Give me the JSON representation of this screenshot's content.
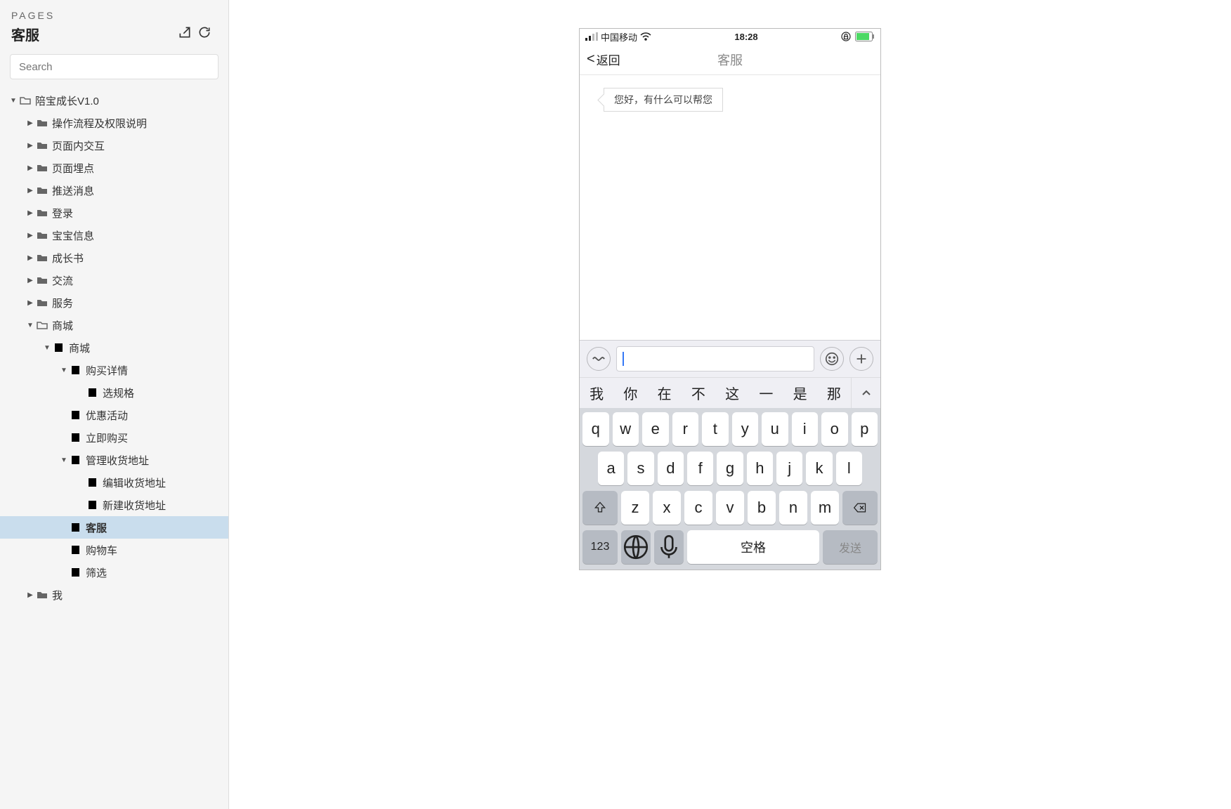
{
  "sidebar": {
    "header_label": "PAGES",
    "current_page": "客服",
    "search_placeholder": "Search",
    "tree": [
      {
        "depth": 0,
        "expanded": true,
        "icon": "folder-open",
        "label": "陪宝成长V1.0"
      },
      {
        "depth": 1,
        "expanded": false,
        "icon": "folder-closed",
        "label": "操作流程及权限说明"
      },
      {
        "depth": 1,
        "expanded": false,
        "icon": "folder-closed",
        "label": "页面内交互"
      },
      {
        "depth": 1,
        "expanded": false,
        "icon": "folder-closed",
        "label": "页面埋点"
      },
      {
        "depth": 1,
        "expanded": false,
        "icon": "folder-closed",
        "label": "推送消息"
      },
      {
        "depth": 1,
        "expanded": false,
        "icon": "folder-closed",
        "label": "登录"
      },
      {
        "depth": 1,
        "expanded": false,
        "icon": "folder-closed",
        "label": "宝宝信息"
      },
      {
        "depth": 1,
        "expanded": false,
        "icon": "folder-closed",
        "label": "成长书"
      },
      {
        "depth": 1,
        "expanded": false,
        "icon": "folder-closed",
        "label": "交流"
      },
      {
        "depth": 1,
        "expanded": false,
        "icon": "folder-closed",
        "label": "服务"
      },
      {
        "depth": 1,
        "expanded": true,
        "icon": "folder-open",
        "label": "商城"
      },
      {
        "depth": 2,
        "expanded": true,
        "icon": "page",
        "label": "商城"
      },
      {
        "depth": 3,
        "expanded": true,
        "icon": "page",
        "label": "购买详情"
      },
      {
        "depth": 4,
        "expanded": null,
        "icon": "page",
        "label": "选规格"
      },
      {
        "depth": 3,
        "expanded": null,
        "icon": "page",
        "label": "优惠活动"
      },
      {
        "depth": 3,
        "expanded": null,
        "icon": "page",
        "label": "立即购买"
      },
      {
        "depth": 3,
        "expanded": true,
        "icon": "page",
        "label": "管理收货地址"
      },
      {
        "depth": 4,
        "expanded": null,
        "icon": "page",
        "label": "编辑收货地址"
      },
      {
        "depth": 4,
        "expanded": null,
        "icon": "page",
        "label": "新建收货地址"
      },
      {
        "depth": 3,
        "expanded": null,
        "icon": "page",
        "label": "客服",
        "selected": true
      },
      {
        "depth": 3,
        "expanded": null,
        "icon": "page",
        "label": "购物车"
      },
      {
        "depth": 3,
        "expanded": null,
        "icon": "page",
        "label": "筛选"
      },
      {
        "depth": 1,
        "expanded": false,
        "icon": "folder-closed",
        "label": "我"
      }
    ]
  },
  "phone": {
    "status": {
      "carrier": "中国移动",
      "time": "18:28"
    },
    "nav": {
      "back": "返回",
      "title": "客服"
    },
    "chat": {
      "msg1": "您好，有什么可以帮您"
    },
    "suggest": [
      "我",
      "你",
      "在",
      "不",
      "这",
      "一",
      "是",
      "那"
    ],
    "keyboard": {
      "row1": [
        "q",
        "w",
        "e",
        "r",
        "t",
        "y",
        "u",
        "i",
        "o",
        "p"
      ],
      "row2": [
        "a",
        "s",
        "d",
        "f",
        "g",
        "h",
        "j",
        "k",
        "l"
      ],
      "row3": [
        "z",
        "x",
        "c",
        "v",
        "b",
        "n",
        "m"
      ],
      "num": "123",
      "space": "空格",
      "send": "发送"
    }
  }
}
